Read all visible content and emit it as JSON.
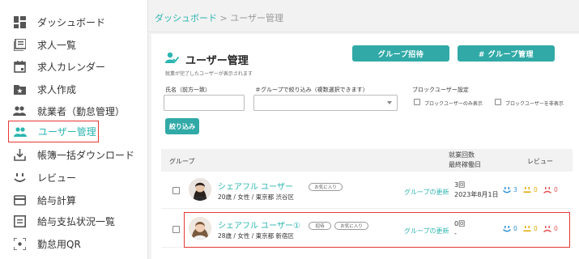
{
  "sidebar": {
    "items": [
      {
        "label": "ダッシュボード",
        "icon": "dashboard-icon"
      },
      {
        "label": "求人一覧",
        "icon": "list-icon"
      },
      {
        "label": "求人カレンダー",
        "icon": "calendar-icon"
      },
      {
        "label": "求人作成",
        "icon": "star-folder-icon"
      },
      {
        "label": "就業者（勤怠管理）",
        "icon": "people-icon"
      },
      {
        "label": "ユーザー管理",
        "icon": "people-icon"
      },
      {
        "label": "帳簿一括ダウンロード",
        "icon": "download-icon"
      },
      {
        "label": "レビュー",
        "icon": "smile-icon"
      },
      {
        "label": "給与計算",
        "icon": "card-icon"
      },
      {
        "label": "給与支払状況一覧",
        "icon": "list-box-icon"
      },
      {
        "label": "勤怠用QR",
        "icon": "qr-scan-icon"
      }
    ],
    "active_index": 5
  },
  "breadcrumb": {
    "home": "ダッシュボード",
    "separator": ">",
    "current": "ユーザー管理"
  },
  "page": {
    "title": "ユーザー管理",
    "subtitle": "就業が完了したユーザーが表示されます",
    "group_invite_button": "グループ招待",
    "group_manage_button": "# グループ管理"
  },
  "filters": {
    "name_label": "氏名（前方一致）",
    "name_value": "",
    "group_label": "＃グループで絞り込み（複数選択できます）",
    "group_value": "",
    "block_label": "ブロックユーザー設定",
    "block_only_label": "ブロックユーザーのみ表示",
    "block_hide_label": "ブロックユーザーを非表示",
    "submit_label": "絞り込み"
  },
  "table": {
    "col_group": "グループ",
    "col_count_line1": "就業回数",
    "col_count_line2": "最終稼働日",
    "col_review": "レビュー",
    "rows": [
      {
        "name": "シェアフル ユーザー",
        "meta": "20歳 / 女性 / 東京都 渋谷区",
        "tags": [
          "お気に入り"
        ],
        "group_link": "グループの更新",
        "count": "3回",
        "last_date": "2023年8月1日",
        "reviews": {
          "good": "3",
          "neutral": "0",
          "bad": "0"
        }
      },
      {
        "name": "シェアフル ユーザー①",
        "meta": "28歳 / 女性 / 東京都 新宿区",
        "tags": [
          "招待",
          "お気に入り"
        ],
        "group_link": "グループの更新",
        "count": "0回",
        "last_date": "-",
        "reviews": {
          "good": "0",
          "neutral": "0",
          "bad": "0"
        }
      }
    ]
  },
  "colors": {
    "accent": "#2bb5b0",
    "button": "#31aaa7",
    "highlight": "#e53935",
    "good": "#2a8fd6",
    "neutral": "#e0a800",
    "bad": "#e55353"
  }
}
